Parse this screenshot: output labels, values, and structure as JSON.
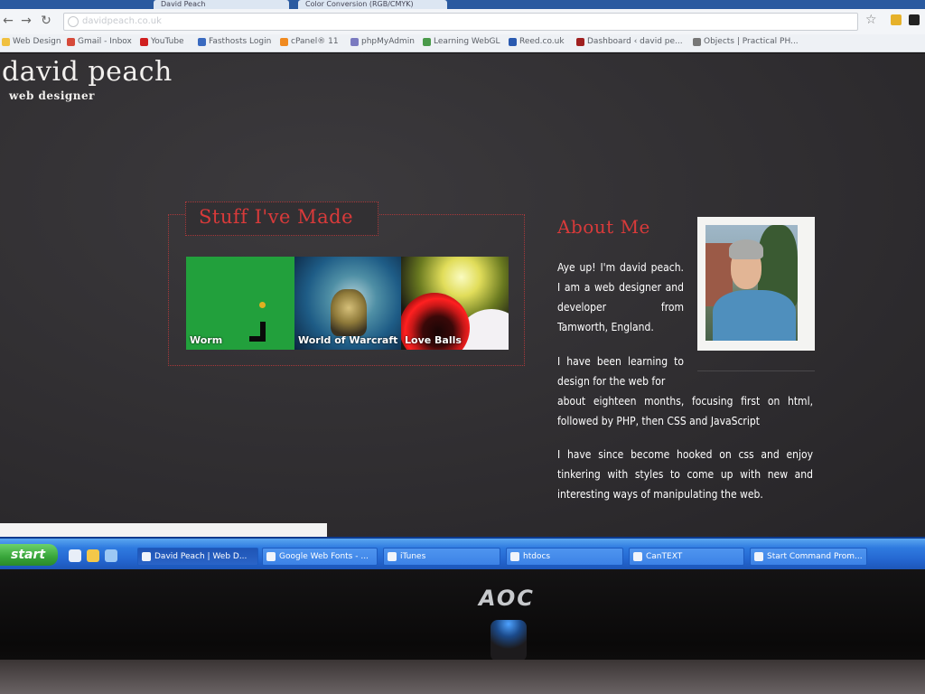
{
  "browser": {
    "tabs": [
      {
        "label": "David Peach"
      },
      {
        "label": "Color Conversion (RGB/CMYK)"
      }
    ],
    "omnibox_placeholder": "davidpeach.co.uk",
    "bookmarks": [
      {
        "label": "Web Design",
        "color": "#f0c040"
      },
      {
        "label": "Gmail - Inbox",
        "color": "#d64a3a"
      },
      {
        "label": "YouTube",
        "color": "#d02020"
      },
      {
        "label": "Fasthosts Login",
        "color": "#3a6ac0"
      },
      {
        "label": "cPanel® 11",
        "color": "#f08a20"
      },
      {
        "label": "phpMyAdmin",
        "color": "#7a7ac0"
      },
      {
        "label": "Learning WebGL",
        "color": "#4a9a4a"
      },
      {
        "label": "Reed.co.uk",
        "color": "#2a5ab0"
      },
      {
        "label": "Dashboard ‹ david pe...",
        "color": "#a02020"
      },
      {
        "label": "Objects | Practical PH...",
        "color": "#777777"
      }
    ]
  },
  "site": {
    "title": "david peach",
    "subtitle": "web designer",
    "made_heading": "Stuff I've Made",
    "projects": [
      {
        "label": "Worm"
      },
      {
        "label": "World of Warcraft"
      },
      {
        "label": "Love Balls"
      }
    ],
    "about_heading": "About Me",
    "about_p1": "Aye up! I'm david peach. I am a web designer and developer from Tamworth, England.",
    "about_p2a": "I have been learning to design for the web for",
    "about_p2b": "about eighteen months, focusing first on html, followed by PHP, then CSS and JavaScript",
    "about_p3": "I have since become hooked on css and enjoy tinkering with styles to come up with new and interesting ways of manipulating the web."
  },
  "taskbar": {
    "start_label": "start",
    "tasks": [
      {
        "label": "David Peach | Web D..."
      },
      {
        "label": "Google Web Fonts - ..."
      },
      {
        "label": "iTunes"
      },
      {
        "label": "htdocs"
      },
      {
        "label": "CanTEXT"
      },
      {
        "label": "Start Command Prom..."
      }
    ]
  },
  "monitor": {
    "brand": "AOC"
  },
  "colors": {
    "accent_red": "#d83a3a",
    "page_bg": "#323033",
    "taskbar_blue": "#2466d0",
    "start_green": "#38a53a"
  }
}
